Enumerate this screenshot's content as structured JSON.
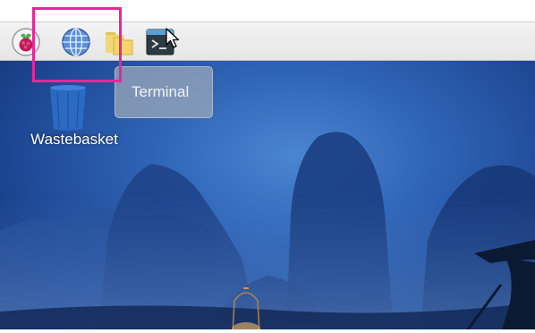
{
  "taskbar": {
    "items": [
      {
        "name": "raspberry-menu-icon"
      },
      {
        "name": "web-browser-icon"
      },
      {
        "name": "file-manager-icon"
      },
      {
        "name": "terminal-icon"
      }
    ]
  },
  "desktop": {
    "wastebasket_label": "Wastebasket"
  },
  "tooltip": {
    "text": "Terminal"
  },
  "colors": {
    "highlight": "#e8269a",
    "desktop_blue": "#2e63b4",
    "panel": "#ececec"
  }
}
